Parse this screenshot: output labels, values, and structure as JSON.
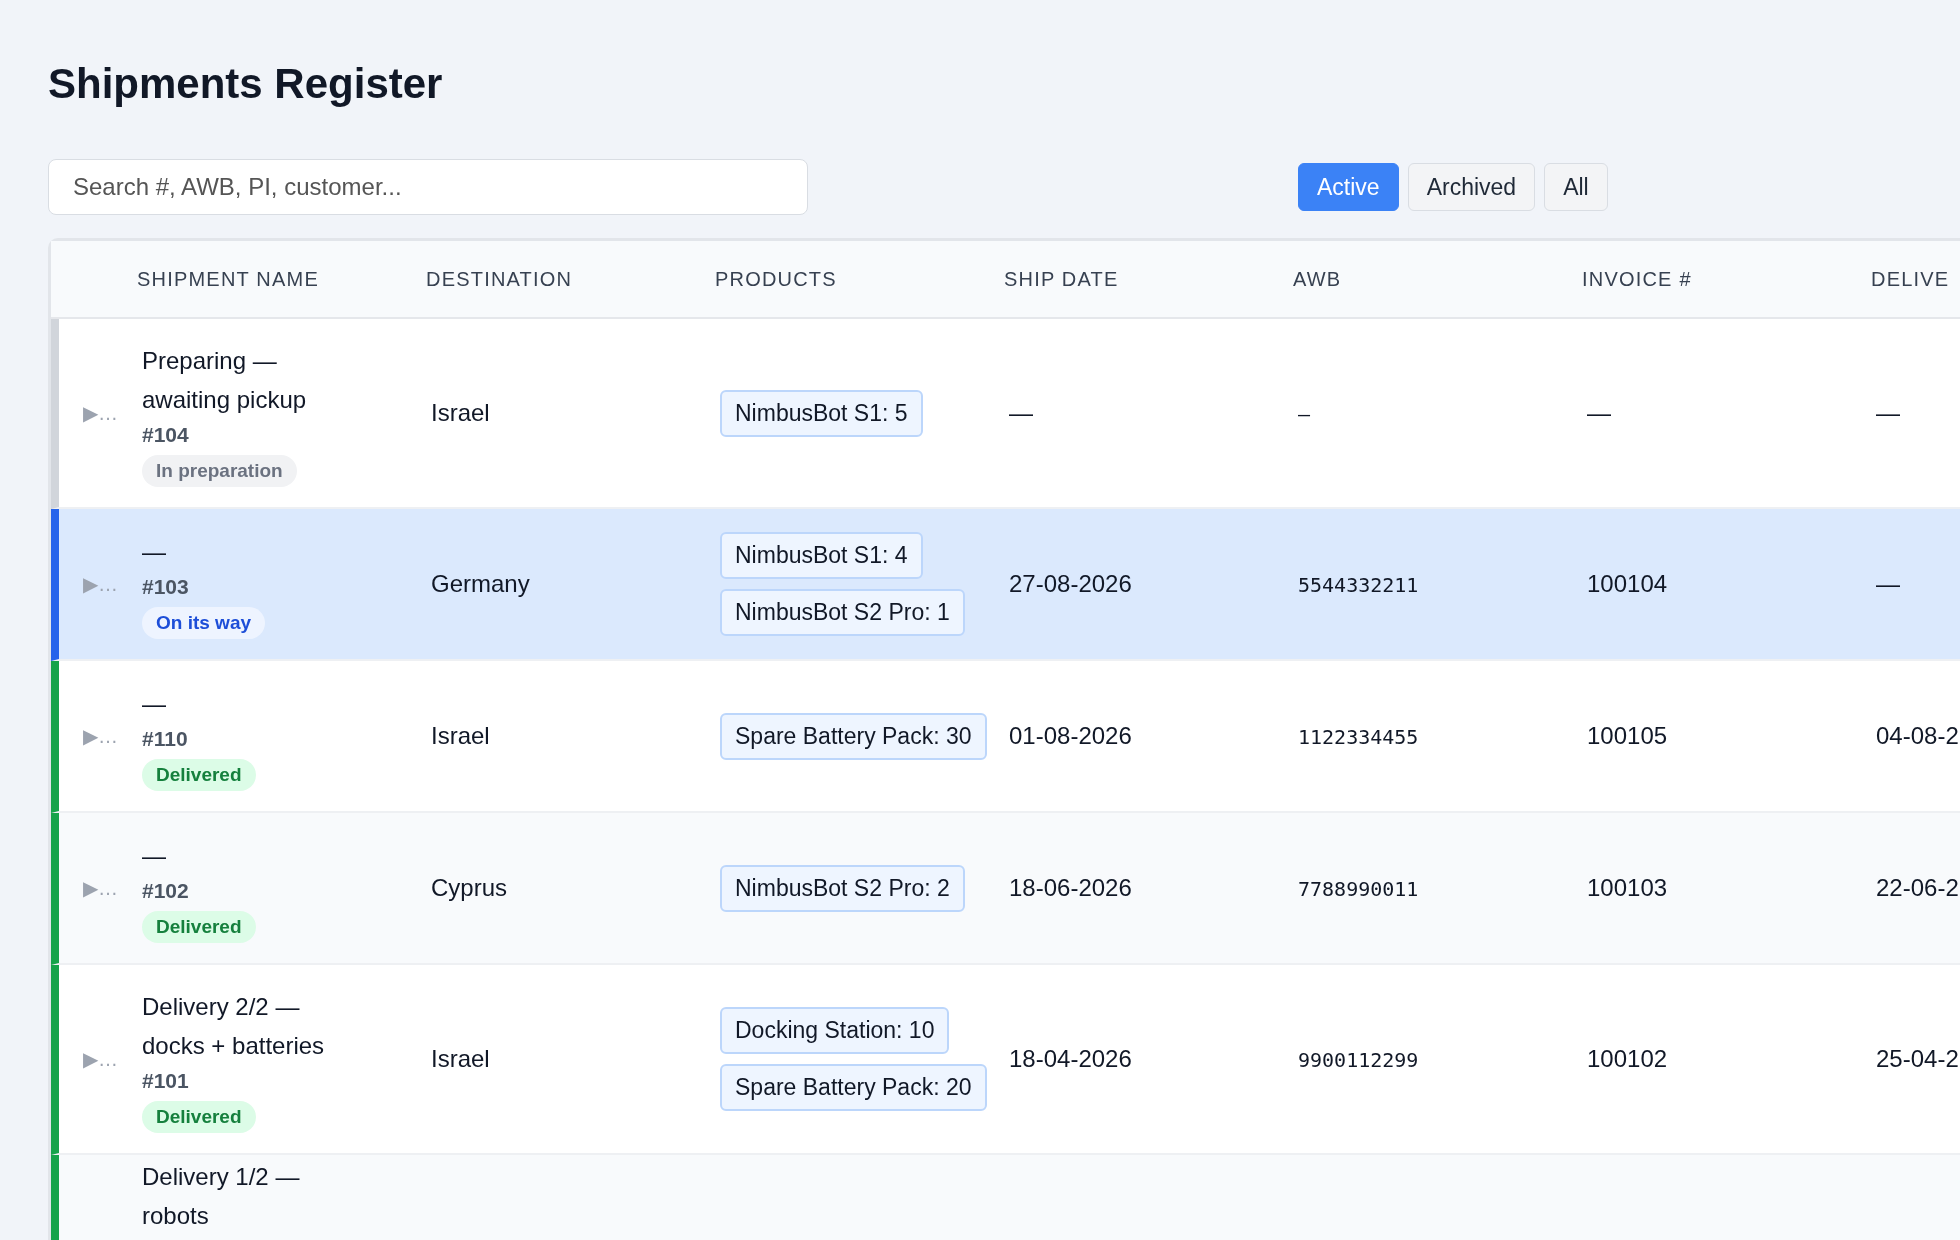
{
  "title": "Shipments Register",
  "search": {
    "placeholder": "Search #, AWB, PI, customer..."
  },
  "filters": [
    {
      "label": "Active",
      "selected": true
    },
    {
      "label": "Archived",
      "selected": false
    },
    {
      "label": "All",
      "selected": false
    }
  ],
  "table": {
    "columns": [
      "SHIPMENT NAME",
      "DESTINATION",
      "PRODUCTS",
      "SHIP DATE",
      "AWB",
      "INVOICE #",
      "DELIVE"
    ],
    "rows": [
      {
        "expander": "▶…",
        "name": "Preparing — awaiting pickup",
        "number": "#104",
        "status": {
          "label": "In preparation",
          "kind": "preparing"
        },
        "selected": false,
        "destination": "Israel",
        "products": [
          "NimbusBot S1: 5"
        ],
        "ship_date": "—",
        "awb": "—",
        "invoice": "—",
        "delivery": "—"
      },
      {
        "expander": "▶…",
        "name": "—",
        "number": "#103",
        "status": {
          "label": "On its way",
          "kind": "transit"
        },
        "selected": true,
        "destination": "Germany",
        "products": [
          "NimbusBot S1: 4",
          "NimbusBot S2 Pro: 1"
        ],
        "ship_date": "27-08-2026",
        "awb": "5544332211",
        "invoice": "100104",
        "delivery": "—"
      },
      {
        "expander": "▶…",
        "name": "—",
        "number": "#110",
        "status": {
          "label": "Delivered",
          "kind": "delivered"
        },
        "selected": false,
        "destination": "Israel",
        "products": [
          "Spare Battery Pack: 30"
        ],
        "ship_date": "01-08-2026",
        "awb": "1122334455",
        "invoice": "100105",
        "delivery": "04-08-2"
      },
      {
        "expander": "▶…",
        "name": "—",
        "number": "#102",
        "status": {
          "label": "Delivered",
          "kind": "delivered"
        },
        "selected": false,
        "destination": "Cyprus",
        "products": [
          "NimbusBot S2 Pro: 2"
        ],
        "ship_date": "18-06-2026",
        "awb": "7788990011",
        "invoice": "100103",
        "delivery": "22-06-2"
      },
      {
        "expander": "▶…",
        "name": "Delivery 2/2 — docks + batteries",
        "number": "#101",
        "status": {
          "label": "Delivered",
          "kind": "delivered"
        },
        "selected": false,
        "destination": "Israel",
        "products": [
          "Docking Station: 10",
          "Spare Battery Pack: 20"
        ],
        "ship_date": "18-04-2026",
        "awb": "9900112299",
        "invoice": "100102",
        "delivery": "25-04-2"
      },
      {
        "name": "Delivery 1/2 — robots",
        "status": {
          "kind": "delivered"
        },
        "selected": false
      }
    ]
  }
}
